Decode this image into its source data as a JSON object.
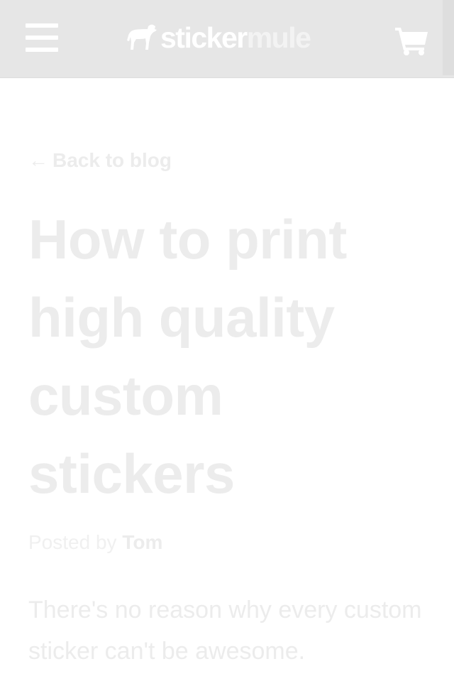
{
  "header": {
    "menu_icon": "hamburger-menu-icon",
    "logo": {
      "part1": "sticker",
      "part2": "mule",
      "icon": "mule-logo-icon"
    },
    "cart_icon": "shopping-cart-icon"
  },
  "article": {
    "back_link": {
      "arrow": "←",
      "label": "Back to blog"
    },
    "title": "How to print high quality custom stickers",
    "byline": {
      "prefix": "Posted by",
      "author": "Tom"
    },
    "intro": "There's no reason why every custom sticker can't be awesome."
  },
  "colors": {
    "header_bg": "#e6e6e6",
    "text_faded": "#ececec"
  }
}
